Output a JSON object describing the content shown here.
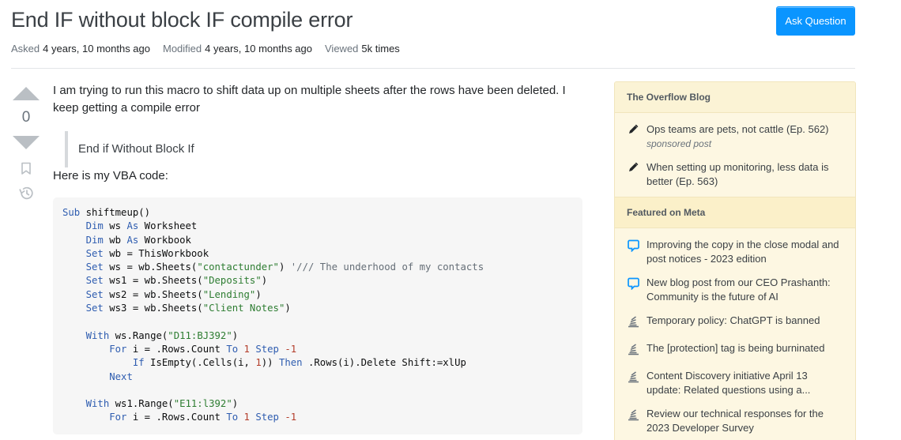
{
  "question": {
    "title": "End IF without block IF compile error",
    "ask_button": "Ask Question",
    "meta": [
      {
        "label": "Asked",
        "value": "4 years, 10 months ago"
      },
      {
        "label": "Modified",
        "value": "4 years, 10 months ago"
      },
      {
        "label": "Viewed",
        "value": "5k times"
      }
    ],
    "vote_count": "0",
    "body": {
      "paragraph1": "I am trying to run this macro to shift data up on multiple sheets after the rows have been deleted. I keep getting a compile error",
      "blockquote": "End if Without Block If",
      "paragraph2": "Here is my VBA code:"
    },
    "code_lines": [
      [
        {
          "t": "Sub",
          "c": "kw"
        },
        {
          "t": " shiftmeup()"
        }
      ],
      [
        {
          "t": "    "
        },
        {
          "t": "Dim",
          "c": "kw"
        },
        {
          "t": " ws "
        },
        {
          "t": "As",
          "c": "kw"
        },
        {
          "t": " Worksheet"
        }
      ],
      [
        {
          "t": "    "
        },
        {
          "t": "Dim",
          "c": "kw"
        },
        {
          "t": " wb "
        },
        {
          "t": "As",
          "c": "kw"
        },
        {
          "t": " Workbook"
        }
      ],
      [
        {
          "t": "    "
        },
        {
          "t": "Set",
          "c": "kw"
        },
        {
          "t": " wb = ThisWorkbook"
        }
      ],
      [
        {
          "t": "    "
        },
        {
          "t": "Set",
          "c": "kw"
        },
        {
          "t": " ws = wb.Sheets("
        },
        {
          "t": "\"contactunder\"",
          "c": "str"
        },
        {
          "t": ") "
        },
        {
          "t": "'/// The underhood of my contacts",
          "c": "cm"
        }
      ],
      [
        {
          "t": "    "
        },
        {
          "t": "Set",
          "c": "kw"
        },
        {
          "t": " ws1 = wb.Sheets("
        },
        {
          "t": "\"Deposits\"",
          "c": "str"
        },
        {
          "t": ")"
        }
      ],
      [
        {
          "t": "    "
        },
        {
          "t": "Set",
          "c": "kw"
        },
        {
          "t": " ws2 = wb.Sheets("
        },
        {
          "t": "\"Lending\"",
          "c": "str"
        },
        {
          "t": ")"
        }
      ],
      [
        {
          "t": "    "
        },
        {
          "t": "Set",
          "c": "kw"
        },
        {
          "t": " ws3 = wb.Sheets("
        },
        {
          "t": "\"Client Notes\"",
          "c": "str"
        },
        {
          "t": ")"
        }
      ],
      [
        {
          "t": ""
        }
      ],
      [
        {
          "t": "    "
        },
        {
          "t": "With",
          "c": "kw"
        },
        {
          "t": " ws.Range("
        },
        {
          "t": "\"D11:BJ392\"",
          "c": "str"
        },
        {
          "t": ")"
        }
      ],
      [
        {
          "t": "        "
        },
        {
          "t": "For",
          "c": "kw"
        },
        {
          "t": " i = .Rows.Count "
        },
        {
          "t": "To",
          "c": "kw"
        },
        {
          "t": " "
        },
        {
          "t": "1",
          "c": "num"
        },
        {
          "t": " "
        },
        {
          "t": "Step",
          "c": "kw"
        },
        {
          "t": " "
        },
        {
          "t": "-1",
          "c": "num"
        }
      ],
      [
        {
          "t": "            "
        },
        {
          "t": "If",
          "c": "kw"
        },
        {
          "t": " IsEmpty(.Cells(i, "
        },
        {
          "t": "1",
          "c": "num"
        },
        {
          "t": ")) "
        },
        {
          "t": "Then",
          "c": "kw"
        },
        {
          "t": " .Rows(i).Delete Shift:=xlUp"
        }
      ],
      [
        {
          "t": "        "
        },
        {
          "t": "Next",
          "c": "kw"
        }
      ],
      [
        {
          "t": ""
        }
      ],
      [
        {
          "t": "    "
        },
        {
          "t": "With",
          "c": "kw"
        },
        {
          "t": " ws1.Range("
        },
        {
          "t": "\"E11:l392\"",
          "c": "str"
        },
        {
          "t": ")"
        }
      ],
      [
        {
          "t": "        "
        },
        {
          "t": "For",
          "c": "kw"
        },
        {
          "t": " i = .Rows.Count "
        },
        {
          "t": "To",
          "c": "kw"
        },
        {
          "t": " "
        },
        {
          "t": "1",
          "c": "num"
        },
        {
          "t": " "
        },
        {
          "t": "Step",
          "c": "kw"
        },
        {
          "t": " "
        },
        {
          "t": "-1",
          "c": "num"
        }
      ]
    ]
  },
  "sidebar": {
    "blog_header": "The Overflow Blog",
    "blog_items": [
      {
        "icon": "pencil-icon",
        "text": "Ops teams are pets, not cattle (Ep. 562)",
        "sub": "sponsored post"
      },
      {
        "icon": "pencil-icon",
        "text": "When setting up monitoring, less data is better (Ep. 563)"
      }
    ],
    "meta_header": "Featured on Meta",
    "meta_items": [
      {
        "icon": "speech-bubble-icon",
        "text": "Improving the copy in the close modal and post notices - 2023 edition"
      },
      {
        "icon": "speech-bubble-icon",
        "text": "New blog post from our CEO Prashanth: Community is the future of AI"
      },
      {
        "icon": "stack-exchange-icon",
        "text": "Temporary policy: ChatGPT is banned"
      },
      {
        "icon": "stack-exchange-icon",
        "text": "The [protection] tag is being burninated"
      },
      {
        "icon": "stack-exchange-icon",
        "text": "Content Discovery initiative April 13 update: Related questions using a..."
      },
      {
        "icon": "stack-exchange-icon",
        "text": "Review our technical responses for the 2023 Developer Survey"
      }
    ]
  },
  "colors": {
    "accent": "#0a95ff",
    "sidebar_bg": "#fbf3d5",
    "keyword": "#2f5db0",
    "string": "#2e7d32",
    "number": "#b33d2a"
  }
}
